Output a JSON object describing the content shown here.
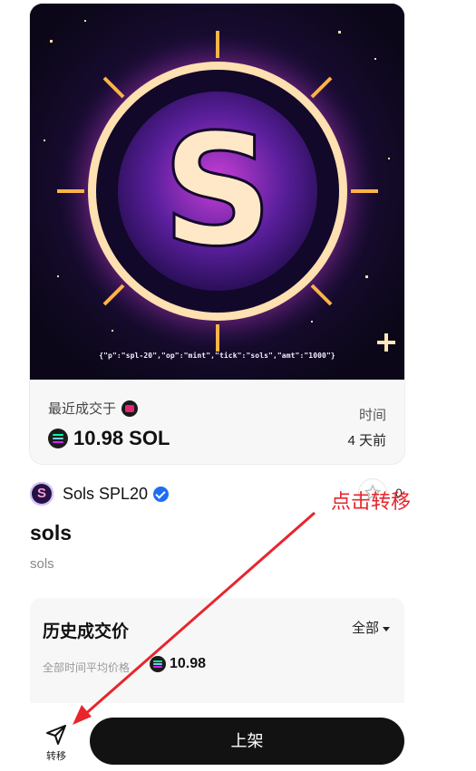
{
  "nft": {
    "image_caption": "{\"p\":\"spl-20\",\"op\":\"mint\",\"tick\":\"sols\",\"amt\":\"1000\"}",
    "last_sale_label": "最近成交于",
    "price": "10.98 SOL",
    "time_label": "时间",
    "time_value": "4 天前"
  },
  "collection": {
    "name": "Sols SPL20",
    "like_count": "0"
  },
  "token": {
    "title": "sols",
    "subtitle": "sols"
  },
  "history": {
    "title": "历史成交价",
    "filter": "全部",
    "avg_label": "全部时间平均价格",
    "avg_value": "10.98"
  },
  "bottom_bar": {
    "transfer_label": "转移",
    "list_label": "上架"
  },
  "annotation": {
    "text": "点击转移",
    "color": "#e8252c"
  },
  "icons": [
    "sol-icon",
    "magic-eden-icon",
    "verified-icon",
    "star-icon",
    "send-icon"
  ]
}
